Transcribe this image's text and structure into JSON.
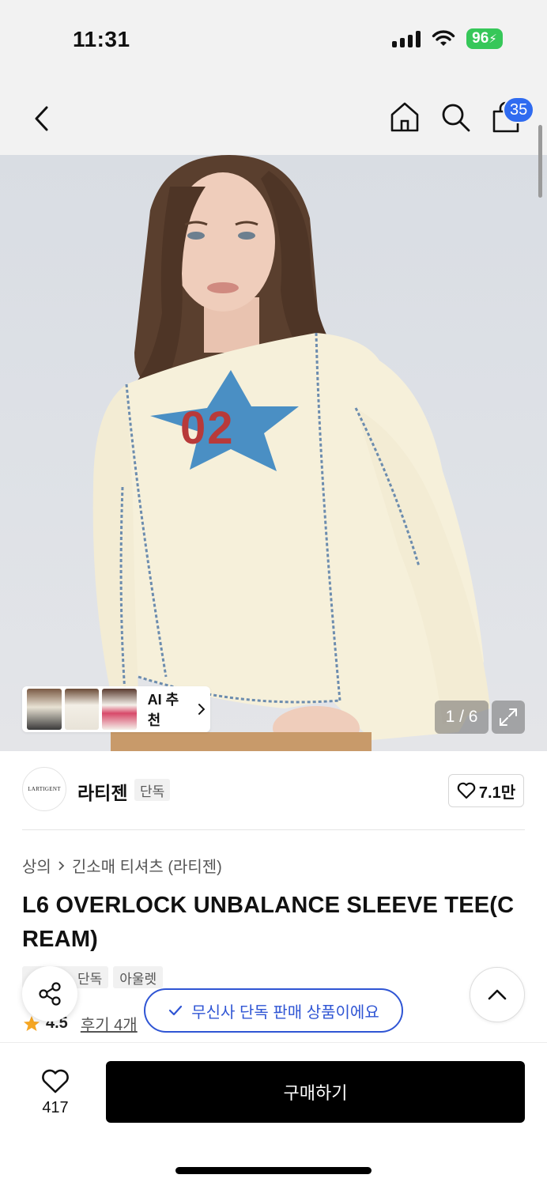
{
  "status_bar": {
    "time": "11:31",
    "battery": "96"
  },
  "nav": {
    "cart_count": "35"
  },
  "gallery": {
    "ai_label": "AI 추천",
    "pager": "1 / 6"
  },
  "brand": {
    "logo_text": "LARTIGENT",
    "name": "라티젠",
    "tag": "단독",
    "likes": "7.1만"
  },
  "breadcrumb": {
    "category": "상의",
    "subcategory": "긴소매 티셔츠 (라티젠)"
  },
  "product": {
    "title": "L6 OVERLOCK UNBALANCE SLEEVE TEE(CREAM)",
    "tags": [
      "단독",
      "아울렛"
    ],
    "rating": "4.5",
    "review_text": "후기 4개"
  },
  "toast": {
    "text": "무신사 단독 판매 상품이에요"
  },
  "bottom": {
    "wish_count": "417",
    "buy_label": "구매하기"
  },
  "colors": {
    "accent": "#2f55d4",
    "badge": "#2f6bf0",
    "battery": "#36c759",
    "star": "#f5a623"
  }
}
